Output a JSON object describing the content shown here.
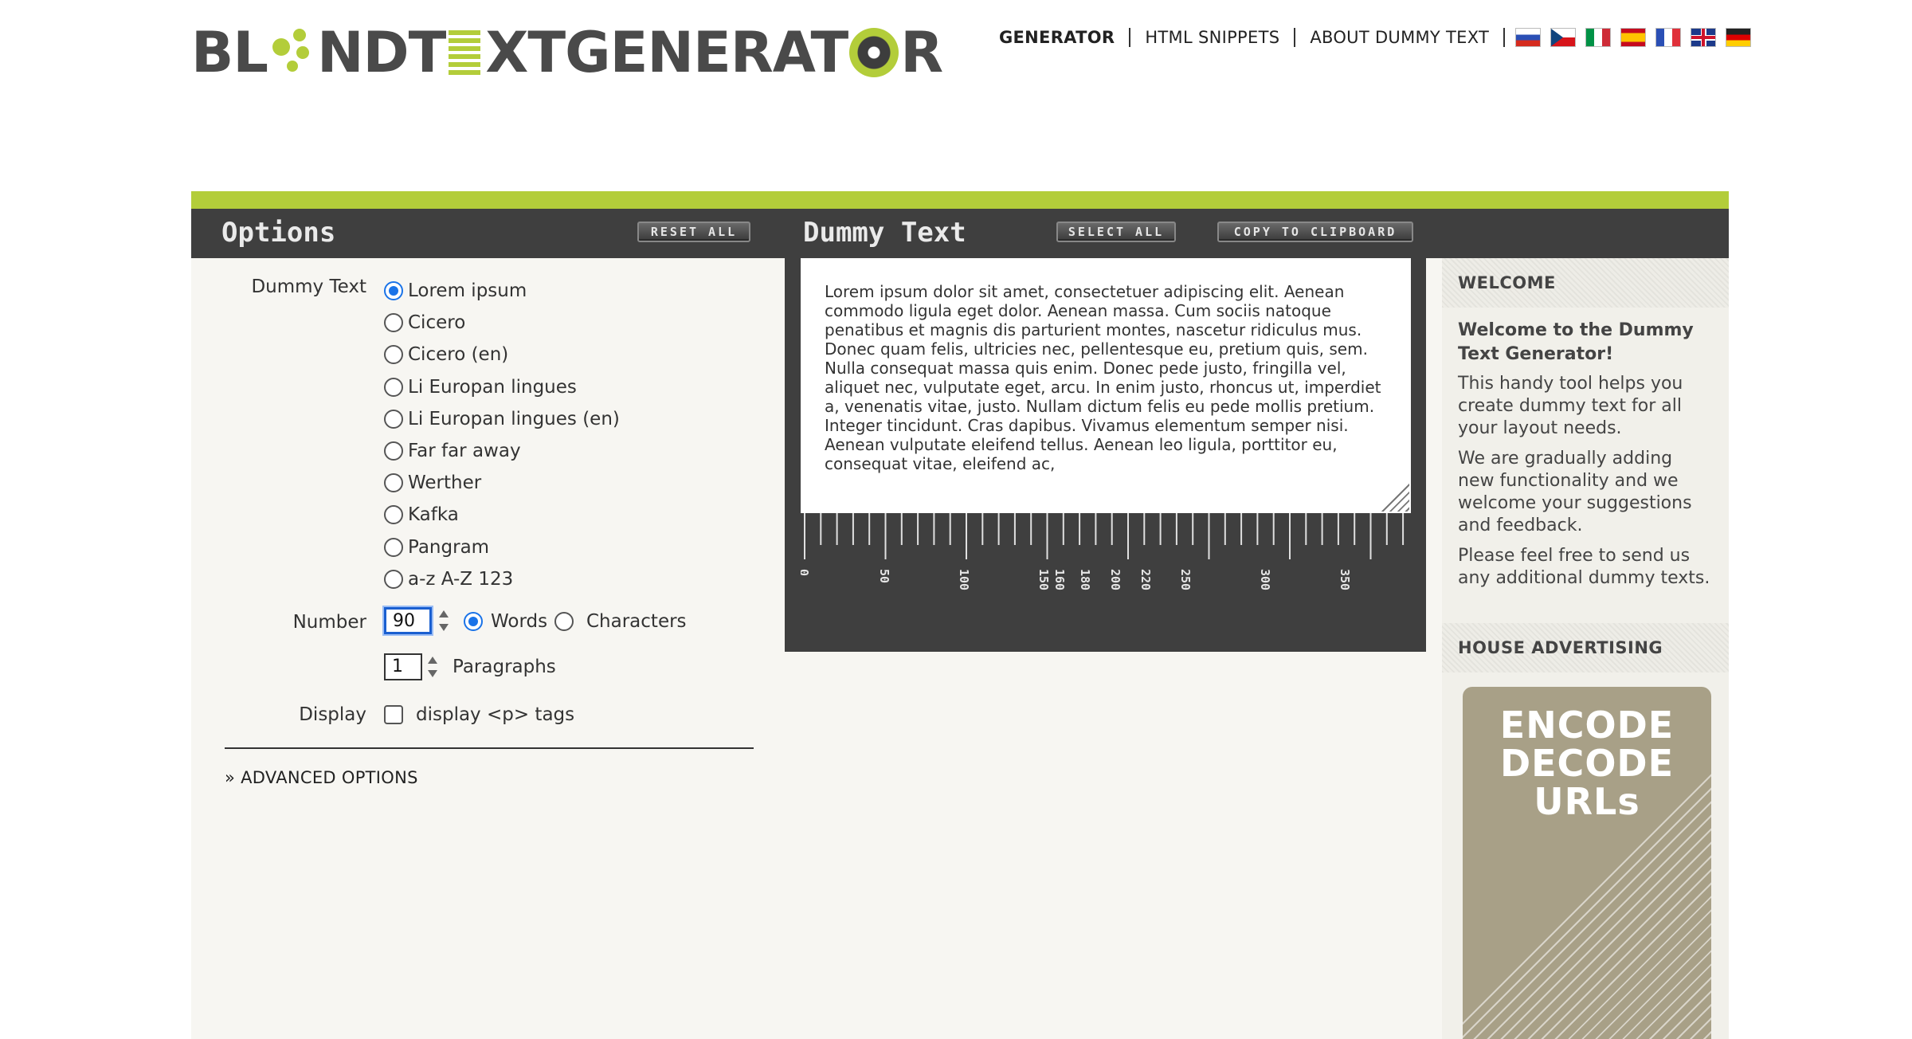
{
  "header": {
    "logo_text": "BLINDTEXTGENERATOR",
    "nav": [
      "GENERATOR",
      "HTML SNIPPETS",
      "ABOUT DUMMY TEXT"
    ],
    "languages": [
      "russian",
      "czech",
      "italian",
      "spanish",
      "french",
      "english",
      "german"
    ]
  },
  "options": {
    "title": "Options",
    "reset_label": "RESET ALL",
    "dummy_text_label": "Dummy Text",
    "dummy_texts": [
      "Lorem ipsum",
      "Cicero",
      "Cicero (en)",
      "Li Europan lingues",
      "Li Europan lingues (en)",
      "Far far away",
      "Werther",
      "Kafka",
      "Pangram",
      "a-z A-Z 123"
    ],
    "selected_dummy_text": "Lorem ipsum",
    "number_label": "Number",
    "number_value": "90",
    "unit_words": "Words",
    "unit_characters": "Characters",
    "selected_unit": "Words",
    "paragraphs_value": "1",
    "paragraphs_label": "Paragraphs",
    "display_label": "Display",
    "display_p_tags_label": "display <p> tags",
    "display_p_tags_checked": false,
    "advanced_label": "» ADVANCED OPTIONS"
  },
  "dummy": {
    "title": "Dummy Text",
    "select_all_label": "SELECT ALL",
    "copy_label": "COPY TO CLIPBOARD",
    "text": "Lorem ipsum dolor sit amet, consectetuer adipiscing elit. Aenean commodo ligula eget dolor. Aenean massa. Cum sociis natoque penatibus et magnis dis parturient montes, nascetur ridiculus mus. Donec quam felis, ultricies nec, pellentesque eu, pretium quis, sem. Nulla consequat massa quis enim. Donec pede justo, fringilla vel, aliquet nec, vulputate eget, arcu. In enim justo, rhoncus ut, imperdiet a, venenatis vitae, justo. Nullam dictum felis eu pede mollis pretium. Integer tincidunt. Cras dapibus. Vivamus elementum semper nisi. Aenean vulputate eleifend tellus. Aenean leo ligula, porttitor eu, consequat vitae, eleifend ac,",
    "ruler_labels": [
      "0",
      "50",
      "100",
      "150",
      "160",
      "180",
      "200",
      "220",
      "250",
      "300",
      "350"
    ]
  },
  "sidebar": {
    "welcome_head": "WELCOME",
    "welcome_title": "Welcome to the Dummy Text Generator!",
    "welcome_p1": "This handy tool helps you create dummy text for all your layout needs.",
    "welcome_p2": "We are gradually adding new functionality and we welcome your suggestions and feedback.",
    "welcome_p3": "Please feel free to send us any additional dummy texts.",
    "ads_head": "HOUSE ADVERTISING",
    "ad_line1": "ENCODE",
    "ad_line2": "DECODE",
    "ad_line3": "URLs"
  },
  "colors": {
    "accent": "#b3cd3a",
    "dark": "#3f3f3f",
    "panel": "#f7f6f2",
    "focus": "#1a73e8"
  }
}
